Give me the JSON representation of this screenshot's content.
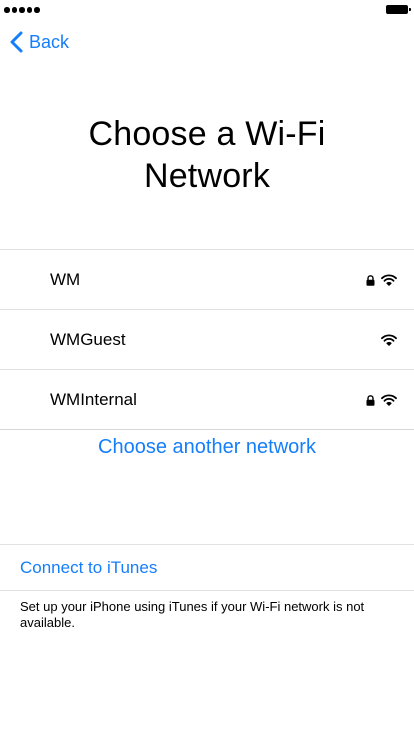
{
  "status_bar": {
    "signal_dots": 5,
    "battery_level": 1.0
  },
  "nav": {
    "back_label": "Back",
    "back_icon": "chevron-left-icon"
  },
  "header": {
    "title_line1": "Choose a Wi-Fi",
    "title_line2": "Network"
  },
  "networks": [
    {
      "name": "WM",
      "secured": true,
      "icons": [
        "lock-icon",
        "wifi-icon"
      ]
    },
    {
      "name": "WMGuest",
      "secured": false,
      "icons": [
        "wifi-icon"
      ]
    },
    {
      "name": "WMInternal",
      "secured": true,
      "icons": [
        "lock-icon",
        "wifi-icon"
      ]
    }
  ],
  "choose_another_label": "Choose another network",
  "itunes": {
    "link_label": "Connect to iTunes",
    "note": "Set up your iPhone using iTunes if your Wi-Fi network is not available."
  },
  "colors": {
    "accent": "#157efb",
    "divider": "#e2e2e2",
    "background": "#ffffff",
    "text": "#000000"
  }
}
